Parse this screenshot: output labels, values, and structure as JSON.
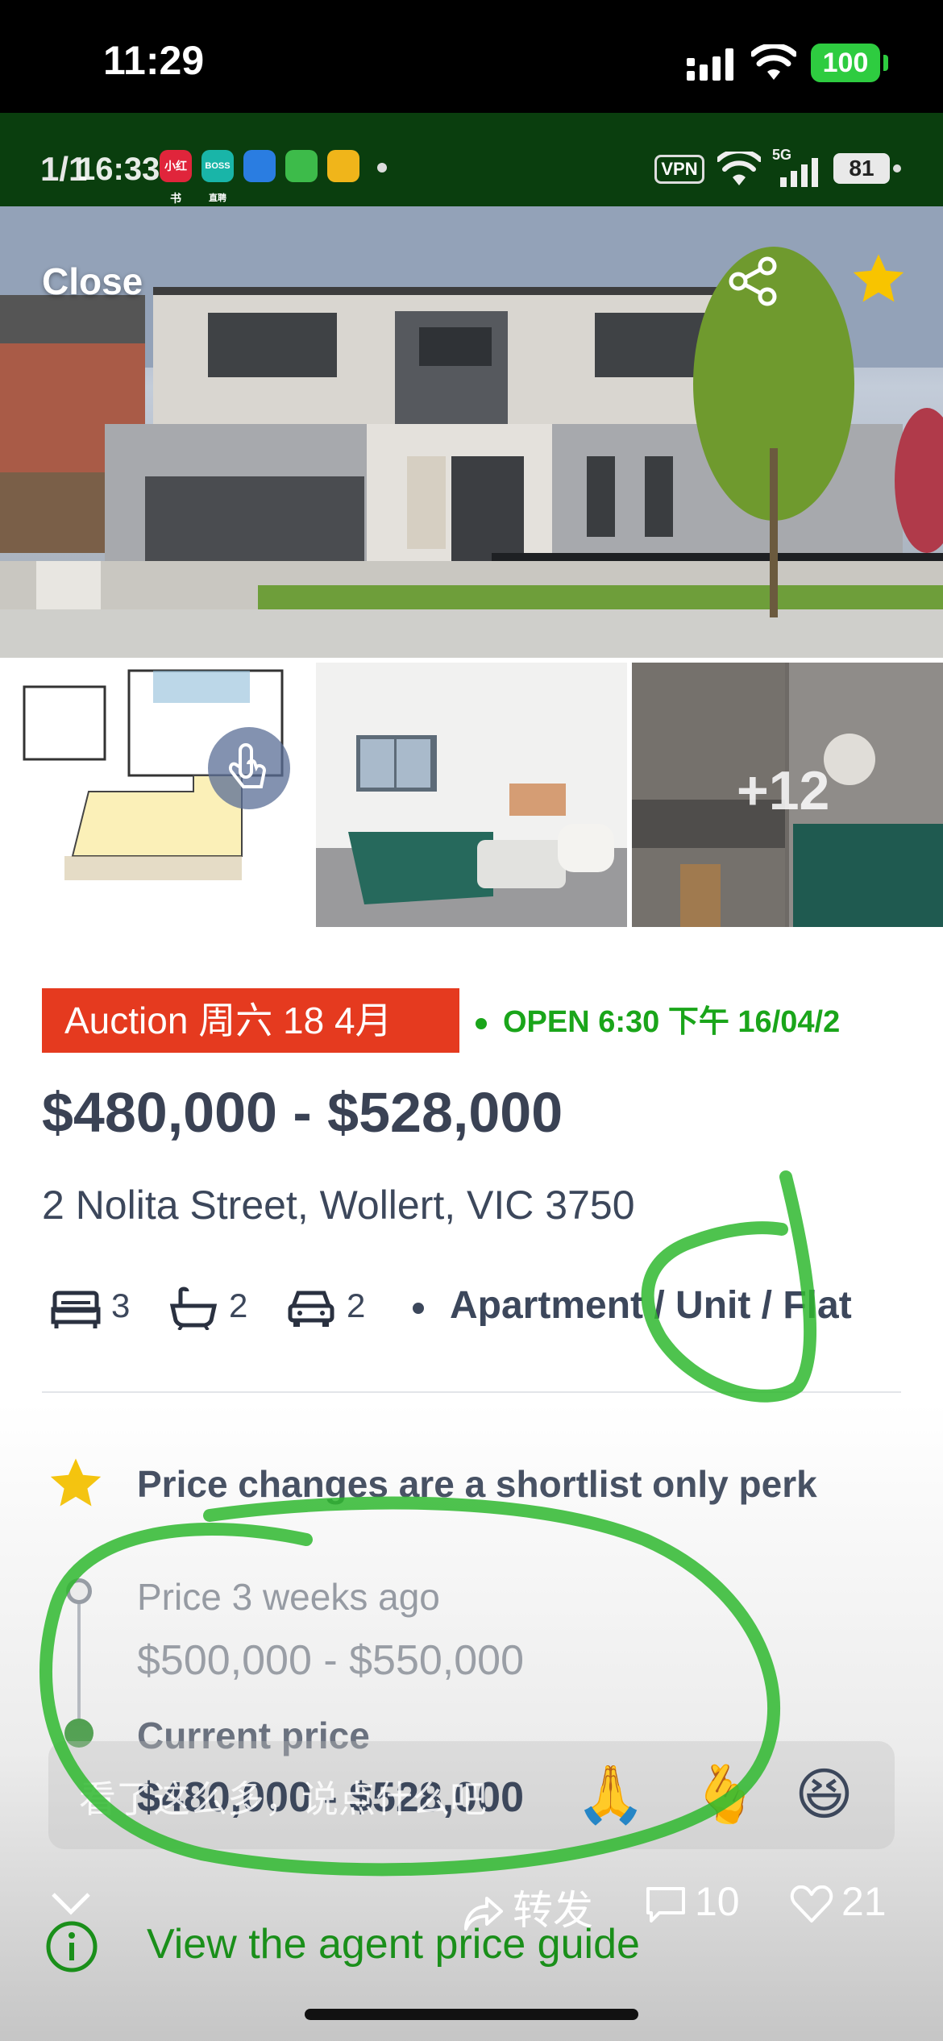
{
  "status_bar": {
    "time": "11:29",
    "battery": "100"
  },
  "embedded_header": {
    "page_indicator": "1/1",
    "time": "16:33",
    "apps": [
      "小红书",
      "BOSS直聘",
      "",
      "",
      ""
    ],
    "vpn": "VPN",
    "network": "5G",
    "battery": "81"
  },
  "hero": {
    "close_label": "Close"
  },
  "thumbnails": {
    "more_count": "+12"
  },
  "listing": {
    "auction_badge": "Auction 周六 18 4月",
    "open_inspection": "OPEN 6:30 下午 16/04/2",
    "price": "$480,000 - $528,000",
    "address": "2 Nolita Street, Wollert, VIC 3750",
    "bedrooms": "3",
    "bathrooms": "2",
    "parking": "2",
    "property_type": "Apartment / Unit / Flat"
  },
  "price_history": {
    "perk_text": "Price changes are a shortlist only perk",
    "previous_label": "Price 3 weeks ago",
    "previous_price": "$500,000 - $550,000",
    "current_label": "Current price",
    "current_price": "$480,000 - $528,000"
  },
  "overlay": {
    "comment_placeholder": "看了这么多，说点什么吧",
    "emojis": [
      "🙏",
      "🫰",
      "😆"
    ],
    "share_label": "转发",
    "comment_count": "10",
    "like_count": "21"
  },
  "agent_guide_label": "View the agent price guide",
  "colors": {
    "brand_green": "#1aa51a",
    "auction_red": "#e53a1f",
    "marker_green": "#2fb82f"
  }
}
